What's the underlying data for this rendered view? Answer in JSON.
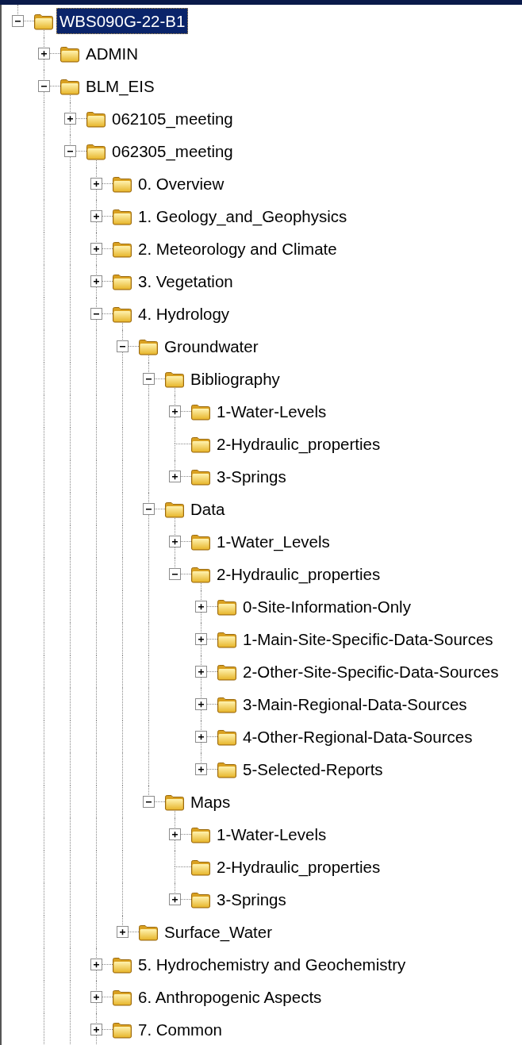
{
  "tree": {
    "cut_off_at_bottom": true,
    "items": [
      {
        "label": "WBS090G-22-B1",
        "selected": true,
        "expanded": true,
        "children": [
          {
            "label": "ADMIN",
            "selected": false,
            "expanded": false
          },
          {
            "label": "BLM_EIS",
            "selected": false,
            "expanded": true,
            "children": [
              {
                "label": "062105_meeting",
                "selected": false,
                "expanded": false
              },
              {
                "label": "062305_meeting",
                "selected": false,
                "expanded": true,
                "children": [
                  {
                    "label": "0. Overview",
                    "selected": false,
                    "expanded": false
                  },
                  {
                    "label": "1. Geology_and_Geophysics",
                    "selected": false,
                    "expanded": false
                  },
                  {
                    "label": "2. Meteorology and Climate",
                    "selected": false,
                    "expanded": false
                  },
                  {
                    "label": "3. Vegetation",
                    "selected": false,
                    "expanded": false
                  },
                  {
                    "label": "4. Hydrology",
                    "selected": false,
                    "expanded": true,
                    "children": [
                      {
                        "label": "Groundwater",
                        "selected": false,
                        "expanded": true,
                        "children": [
                          {
                            "label": "Bibliography",
                            "selected": false,
                            "expanded": true,
                            "children": [
                              {
                                "label": "1-Water-Levels",
                                "selected": false,
                                "expanded": false
                              },
                              {
                                "label": "2-Hydraulic_properties",
                                "selected": false
                              },
                              {
                                "label": "3-Springs",
                                "selected": false,
                                "expanded": false
                              }
                            ]
                          },
                          {
                            "label": "Data",
                            "selected": false,
                            "expanded": true,
                            "children": [
                              {
                                "label": "1-Water_Levels",
                                "selected": false,
                                "expanded": false
                              },
                              {
                                "label": "2-Hydraulic_properties",
                                "selected": false,
                                "expanded": true,
                                "children": [
                                  {
                                    "label": "0-Site-Information-Only",
                                    "selected": false,
                                    "expanded": false
                                  },
                                  {
                                    "label": "1-Main-Site-Specific-Data-Sources",
                                    "selected": false,
                                    "expanded": false
                                  },
                                  {
                                    "label": "2-Other-Site-Specific-Data-Sources",
                                    "selected": false,
                                    "expanded": false
                                  },
                                  {
                                    "label": "3-Main-Regional-Data-Sources",
                                    "selected": false,
                                    "expanded": false
                                  },
                                  {
                                    "label": "4-Other-Regional-Data-Sources",
                                    "selected": false,
                                    "expanded": false
                                  },
                                  {
                                    "label": "5-Selected-Reports",
                                    "selected": false,
                                    "expanded": false
                                  }
                                ]
                              }
                            ]
                          },
                          {
                            "label": "Maps",
                            "selected": false,
                            "expanded": true,
                            "children": [
                              {
                                "label": "1-Water-Levels",
                                "selected": false,
                                "expanded": false
                              },
                              {
                                "label": "2-Hydraulic_properties",
                                "selected": false
                              },
                              {
                                "label": "3-Springs",
                                "selected": false,
                                "expanded": false
                              }
                            ]
                          }
                        ]
                      },
                      {
                        "label": "Surface_Water",
                        "selected": false,
                        "expanded": false
                      }
                    ]
                  },
                  {
                    "label": "5. Hydrochemistry and Geochemistry",
                    "selected": false,
                    "expanded": false
                  },
                  {
                    "label": "6. Anthropogenic Aspects",
                    "selected": false,
                    "expanded": false
                  },
                  {
                    "label": "7. Common",
                    "selected": false,
                    "expanded": false
                  }
                ]
              }
            ]
          }
        ]
      }
    ]
  }
}
